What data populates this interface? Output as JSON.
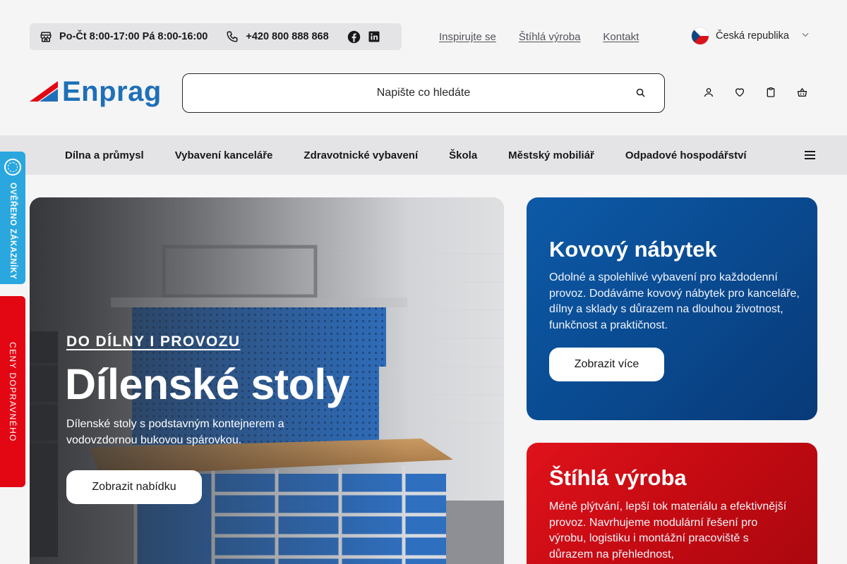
{
  "topbar": {
    "hours": "Po-Čt 8:00-17:00 Pá 8:00-16:00",
    "phone": "+420 800 888 868",
    "links": [
      "Inspirujte se",
      "Štíhlá výroba",
      "Kontakt"
    ],
    "country": "Česká republika"
  },
  "header": {
    "logo_text": "Enprag",
    "search_placeholder": "Napište co hledáte"
  },
  "nav": {
    "items": [
      "Dílna a průmysl",
      "Vybavení kanceláře",
      "Zdravotnické vybavení",
      "Škola",
      "Městský mobiliář",
      "Odpadové hospodářství"
    ]
  },
  "side": {
    "verified": "OVĚŘENO ZÁKAZNÍKY",
    "prices": "CENY DOPRAVNÉHO"
  },
  "hero": {
    "kicker": "DO DÍLNY I PROVOZU",
    "title": "Dílenské stoly",
    "description": "Dílenské stoly s podstavným kontejnerem a vodovzdornou bukovou spárovkou.",
    "button": "Zobrazit nabídku"
  },
  "cards": [
    {
      "title": "Kovový nábytek",
      "description": "Odolné a spolehlivé vybavení pro každodenní provoz. Dodáváme kovový nábytek pro kanceláře, dílny a sklady s důrazem na dlouhou životnost, funkčnost a praktičnost.",
      "button": "Zobrazit více"
    },
    {
      "title": "Štíhlá výroba",
      "description": "Méně plýtvání, lepší tok materiálu a efektivnější provoz. Navrhujeme modulární řešení pro výrobu, logistiku i montážní pracoviště s důrazem na přehlednost,"
    }
  ],
  "colors": {
    "brand_blue": "#1e6fb8",
    "brand_red": "#e30613",
    "verified_blue": "#2aa7df",
    "card_blue": "#0a4c93",
    "card_red": "#c40a12"
  }
}
